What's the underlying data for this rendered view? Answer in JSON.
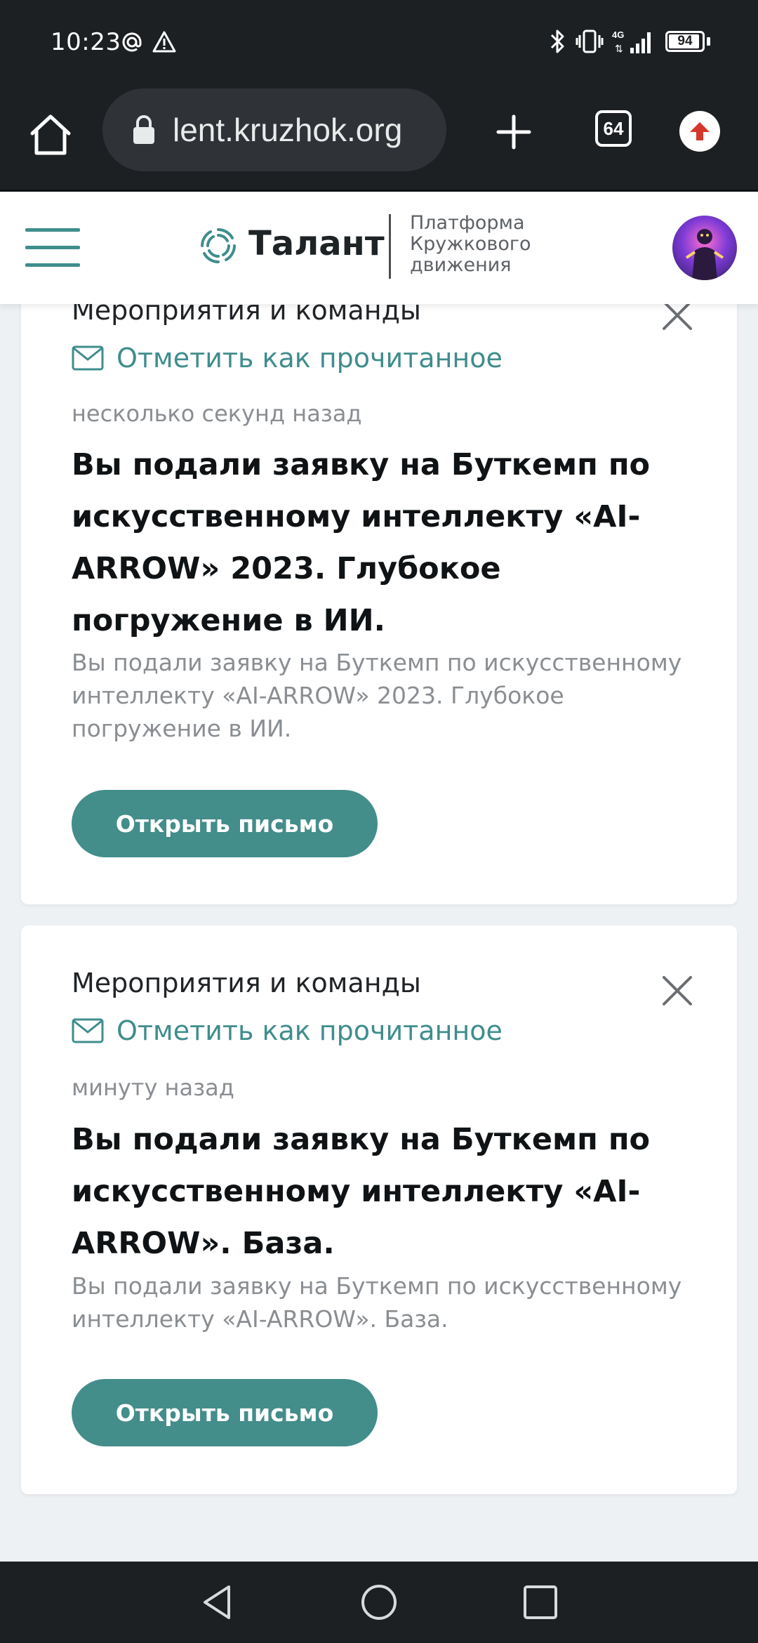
{
  "status_bar": {
    "time": "10:23",
    "left_icons": [
      "at-sign-icon",
      "warning-icon"
    ],
    "right_icons": [
      "bluetooth-icon",
      "vibrate-icon",
      "signal-4g-icon"
    ],
    "battery": "94",
    "battery_level": 0.94
  },
  "browser": {
    "url": "lent.kruzhok.org",
    "tab_count": "64"
  },
  "site_header": {
    "logo_name": "Талант",
    "tagline": "Платформа\nКружкового\nдвижения"
  },
  "notifications": [
    {
      "category": "Мероприятия и команды",
      "mark_read_label": "Отметить как прочитанное",
      "time": "несколько секунд назад",
      "title": "Вы подали заявку на Буткемп по искусственному интеллекту «AI-ARROW» 2023. Глубокое погружение в ИИ.",
      "body": "Вы подали заявку на Буткемп по искусственному интеллекту «AI-ARROW» 2023. Глубокое погружение в ИИ.",
      "open_label": "Открыть письмо"
    },
    {
      "category": "Мероприятия и команды",
      "mark_read_label": "Отметить как прочитанное",
      "time": "минуту назад",
      "title": "Вы подали заявку на Буткемп по искусственному интеллекту «AI-ARROW». База.",
      "body": "Вы подали заявку на Буткемп по искусственному интеллекту «AI-ARROW». База.",
      "open_label": "Открыть письмо"
    }
  ],
  "colors": {
    "accent": "#438d8b",
    "link": "#3f8d8c",
    "chrome": "#1d2023",
    "page_background": "#eef1f4"
  }
}
